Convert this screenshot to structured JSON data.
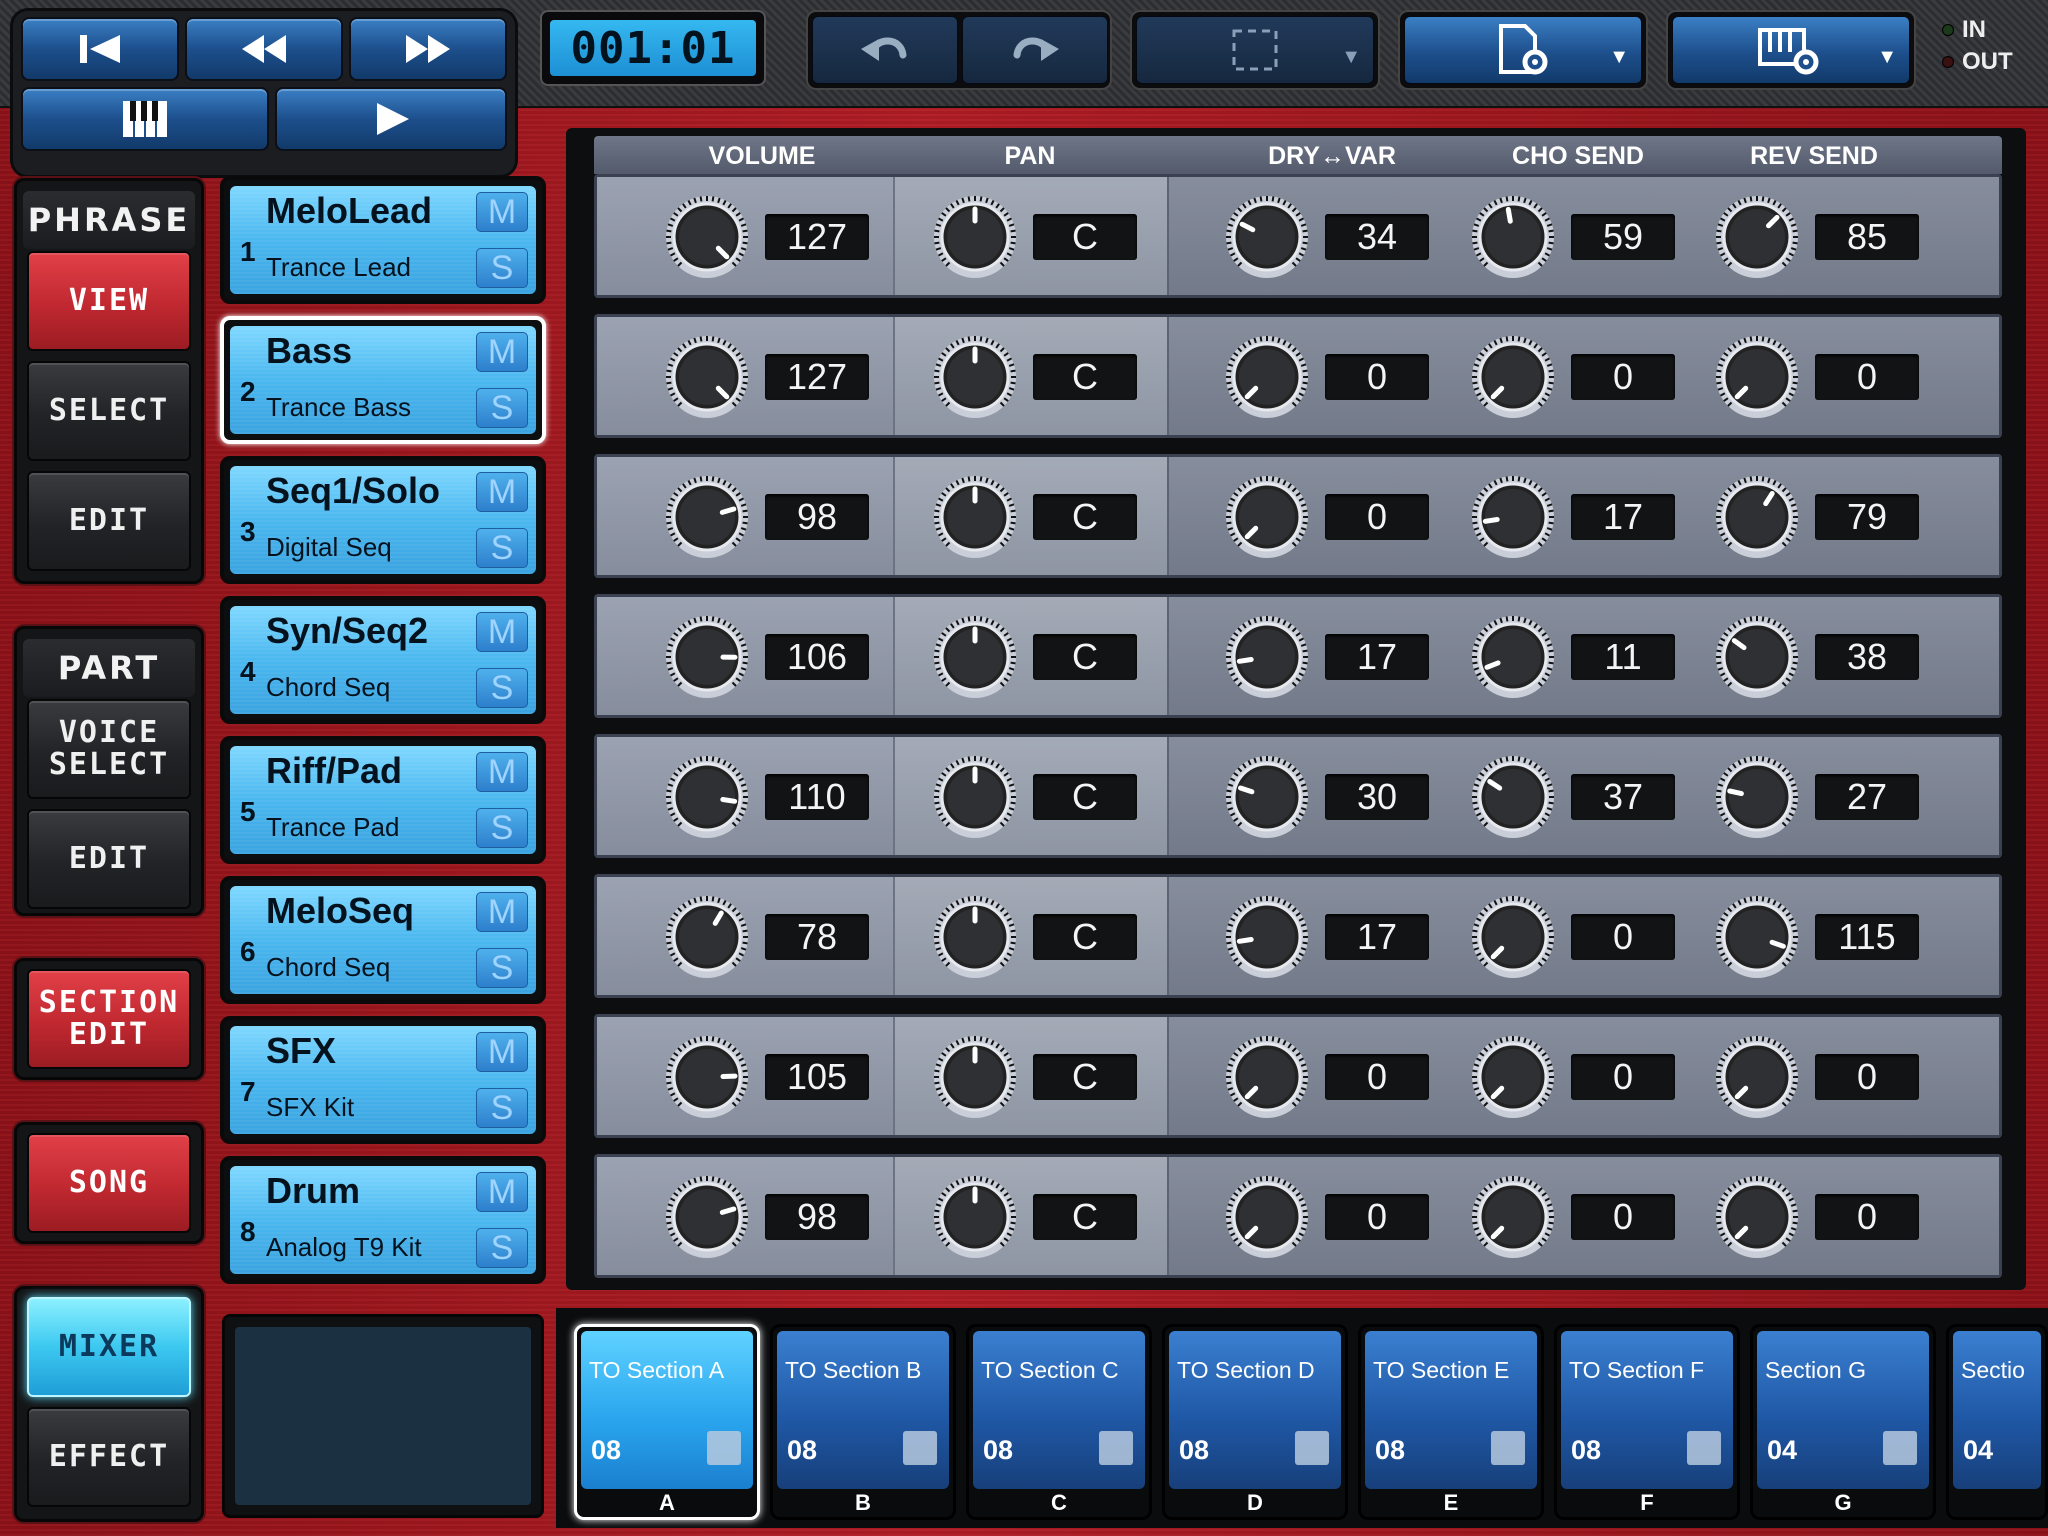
{
  "transport": {
    "counter": "001:01",
    "buttons": [
      "skip-to-start",
      "rewind",
      "fast-forward",
      "keyboard",
      "play"
    ]
  },
  "io": {
    "in_label": "IN",
    "out_label": "OUT"
  },
  "nav": {
    "phrase_header": "PHRASE",
    "view": "VIEW",
    "select": "SELECT",
    "phrase_edit": "EDIT",
    "part_header": "PART",
    "voice_select": "VOICE SELECT",
    "part_edit": "EDIT",
    "section_edit": "SECTION EDIT",
    "song": "SONG",
    "mixer": "MIXER",
    "effect": "EFFECT"
  },
  "parts": [
    {
      "num": "1",
      "name": "MeloLead",
      "voice": "Trance Lead",
      "m": "M",
      "s": "S"
    },
    {
      "num": "2",
      "name": "Bass",
      "voice": "Trance Bass",
      "m": "M",
      "s": "S"
    },
    {
      "num": "3",
      "name": "Seq1/Solo",
      "voice": "Digital Seq",
      "m": "M",
      "s": "S"
    },
    {
      "num": "4",
      "name": "Syn/Seq2",
      "voice": "Chord Seq",
      "m": "M",
      "s": "S"
    },
    {
      "num": "5",
      "name": "Riff/Pad",
      "voice": "Trance Pad",
      "m": "M",
      "s": "S"
    },
    {
      "num": "6",
      "name": "MeloSeq",
      "voice": "Chord Seq",
      "m": "M",
      "s": "S"
    },
    {
      "num": "7",
      "name": "SFX",
      "voice": "SFX Kit",
      "m": "M",
      "s": "S"
    },
    {
      "num": "8",
      "name": "Drum",
      "voice": "Analog T9 Kit",
      "m": "M",
      "s": "S"
    }
  ],
  "selected_part": 1,
  "mixer": {
    "headers": {
      "volume": "VOLUME",
      "pan": "PAN",
      "dry_var": "DRY↔VAR",
      "cho": "CHO SEND",
      "rev": "REV SEND"
    },
    "rows": [
      {
        "volume": "127",
        "pan": "C",
        "dry_var": "34",
        "cho": "59",
        "rev": "85"
      },
      {
        "volume": "127",
        "pan": "C",
        "dry_var": "0",
        "cho": "0",
        "rev": "0"
      },
      {
        "volume": "98",
        "pan": "C",
        "dry_var": "0",
        "cho": "17",
        "rev": "79"
      },
      {
        "volume": "106",
        "pan": "C",
        "dry_var": "17",
        "cho": "11",
        "rev": "38"
      },
      {
        "volume": "110",
        "pan": "C",
        "dry_var": "30",
        "cho": "37",
        "rev": "27"
      },
      {
        "volume": "78",
        "pan": "C",
        "dry_var": "17",
        "cho": "0",
        "rev": "115"
      },
      {
        "volume": "105",
        "pan": "C",
        "dry_var": "0",
        "cho": "0",
        "rev": "0"
      },
      {
        "volume": "98",
        "pan": "C",
        "dry_var": "0",
        "cho": "0",
        "rev": "0"
      }
    ]
  },
  "sections": [
    {
      "name": "TO Section A",
      "len": "08",
      "letter": "A"
    },
    {
      "name": "TO Section B",
      "len": "08",
      "letter": "B"
    },
    {
      "name": "TO Section C",
      "len": "08",
      "letter": "C"
    },
    {
      "name": "TO Section D",
      "len": "08",
      "letter": "D"
    },
    {
      "name": "TO Section E",
      "len": "08",
      "letter": "E"
    },
    {
      "name": "TO Section F",
      "len": "08",
      "letter": "F"
    },
    {
      "name": "Section G",
      "len": "04",
      "letter": "G"
    },
    {
      "name": "Sectio",
      "len": "04",
      "letter": ""
    }
  ],
  "active_section": 0,
  "colors": {
    "accent_blue": "#3aa3e0",
    "frame_red": "#b21d25",
    "lcd_cyan": "#35b8f0"
  }
}
